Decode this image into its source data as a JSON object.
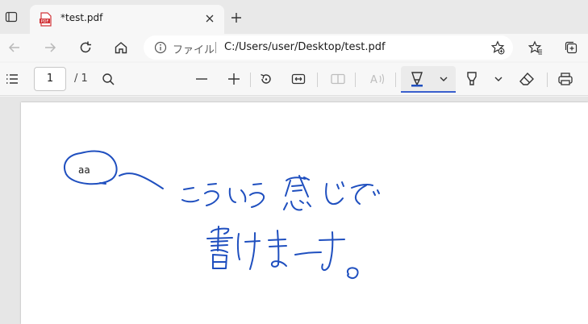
{
  "tab": {
    "title": "*test.pdf",
    "favicon": "pdf-icon"
  },
  "address": {
    "scheme_label": "ファイル",
    "url": "C:/Users/user/Desktop/test.pdf"
  },
  "pdf_toolbar": {
    "page_value": "1",
    "page_count": "/ 1"
  },
  "annotation": {
    "text": "aa",
    "ink_color": "#1f4fbf",
    "handwriting": "こういう感じで書けまーす。"
  },
  "colors": {
    "accent": "#3a5fcd",
    "pdf_icon": "#d13438"
  }
}
